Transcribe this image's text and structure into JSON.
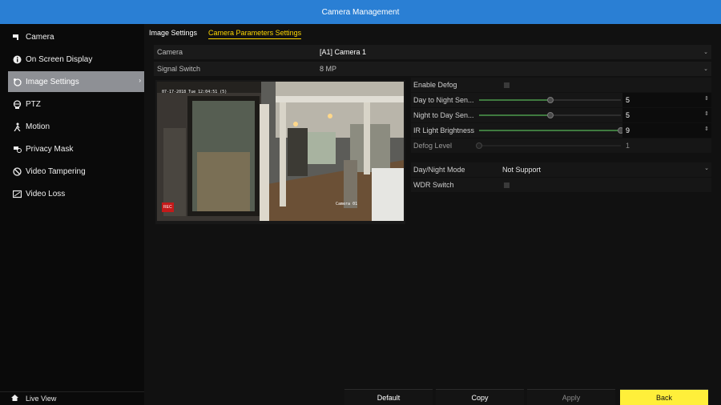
{
  "window": {
    "title": "Camera Management"
  },
  "sidebar": {
    "items": [
      {
        "label": "Camera",
        "icon": "camera-icon"
      },
      {
        "label": "On Screen Display",
        "icon": "info-icon"
      },
      {
        "label": "Image Settings",
        "icon": "image-settings-icon",
        "active": true
      },
      {
        "label": "PTZ",
        "icon": "ptz-icon"
      },
      {
        "label": "Motion",
        "icon": "motion-icon"
      },
      {
        "label": "Privacy Mask",
        "icon": "privacy-mask-icon"
      },
      {
        "label": "Video Tampering",
        "icon": "tamper-icon"
      },
      {
        "label": "Video Loss",
        "icon": "video-loss-icon"
      }
    ],
    "footer": {
      "label": "Live View",
      "icon": "home-icon"
    }
  },
  "tabs": [
    {
      "label": "Image Settings",
      "active": false
    },
    {
      "label": "Camera Parameters Settings",
      "active": true
    }
  ],
  "form": {
    "camera": {
      "label": "Camera",
      "value": "[A1] Camera 1"
    },
    "signal": {
      "label": "Signal Switch",
      "value": "8 MP"
    }
  },
  "preview": {
    "timestamp": "07-17-2018 Tue 12:04:51 (5)",
    "camera_name": "Camera 01",
    "rec_label": "REC"
  },
  "params": {
    "enable_defog": {
      "label": "Enable Defog",
      "checked": false
    },
    "day_to_night": {
      "label": "Day to Night Sen...",
      "value": "5",
      "level": 0.5
    },
    "night_to_day": {
      "label": "Night to Day Sen...",
      "value": "5",
      "level": 0.5
    },
    "ir_light": {
      "label": "IR Light Brightness",
      "value": "9",
      "level": 1.0
    },
    "defog_level": {
      "label": "Defog Level",
      "value": "1",
      "level": 0.0
    },
    "day_night_mode": {
      "label": "Day/Night Mode",
      "value": "Not Support"
    },
    "wdr_switch": {
      "label": "WDR Switch",
      "checked": false
    }
  },
  "buttons": {
    "default": "Default",
    "copy": "Copy",
    "apply": "Apply",
    "back": "Back"
  },
  "colors": {
    "title_bar": "#2a7fd4",
    "active_tab": "#ffd700",
    "back_button": "#ffef3a",
    "slider_fill": "#3f7a3f"
  }
}
